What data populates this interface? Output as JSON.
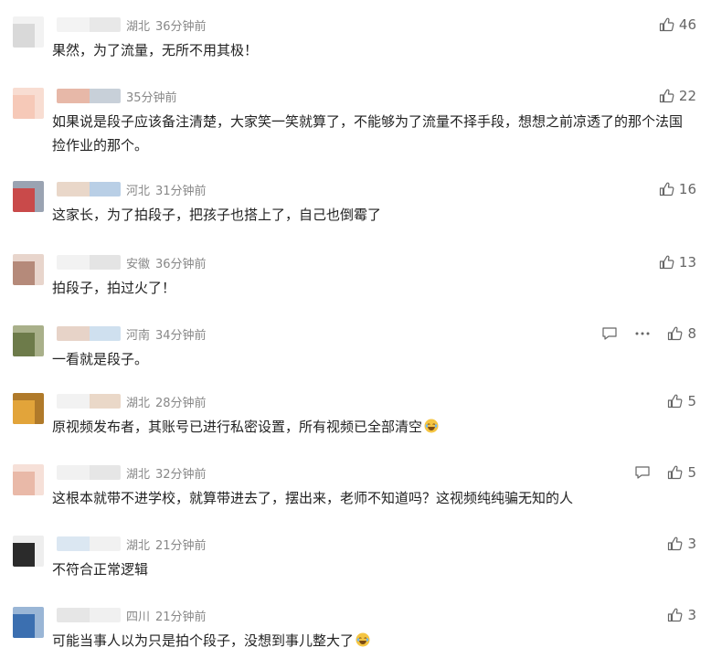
{
  "comments": [
    {
      "region": "湖北",
      "time": "36分钟前",
      "text": "果然，为了流量，无所不用其极！",
      "likes": "46",
      "avatar_colors": [
        "#d9d9d9",
        "#f2f2f2"
      ],
      "nick_colors": [
        "#f3f3f3",
        "#e8e8e8"
      ],
      "has_reply": false,
      "has_more": false
    },
    {
      "region": "",
      "time": "35分钟前",
      "text": "如果说是段子应该备注清楚，大家笑一笑就算了，不能够为了流量不择手段，想想之前凉透了的那个法国捡作业的那个。",
      "likes": "22",
      "avatar_colors": [
        "#f6c9b8",
        "#f8ddd2"
      ],
      "nick_colors": [
        "#e7b8a8",
        "#c8d0d9"
      ],
      "has_reply": false,
      "has_more": false
    },
    {
      "region": "河北",
      "time": "31分钟前",
      "text": "这家长，为了拍段子，把孩子也搭上了，自己也倒霉了",
      "likes": "16",
      "avatar_colors": [
        "#c94a4a",
        "#9aa3b2"
      ],
      "nick_colors": [
        "#e9d7c9",
        "#b9cfe6"
      ],
      "has_reply": false,
      "has_more": false
    },
    {
      "region": "安徽",
      "time": "36分钟前",
      "text": "拍段子，拍过火了！",
      "likes": "13",
      "avatar_colors": [
        "#b58a7a",
        "#e8d5cc"
      ],
      "nick_colors": [
        "#f2f2f2",
        "#e4e4e4"
      ],
      "has_reply": false,
      "has_more": false
    },
    {
      "region": "河南",
      "time": "34分钟前",
      "text": "一看就是段子。",
      "likes": "8",
      "avatar_colors": [
        "#6d7b4a",
        "#a9b08a"
      ],
      "nick_colors": [
        "#e7d3c8",
        "#cfe0ef"
      ],
      "has_reply": true,
      "has_more": true
    },
    {
      "region": "湖北",
      "time": "28分钟前",
      "text": "原视频发布者，其账号已进行私密设置，所有视频已全部清空",
      "likes": "5",
      "avatar_colors": [
        "#e2a43a",
        "#b07a2a"
      ],
      "nick_colors": [
        "#f2f2f2",
        "#ead8c8"
      ],
      "has_reply": false,
      "has_more": false,
      "emoji": "laugh"
    },
    {
      "region": "湖北",
      "time": "32分钟前",
      "text": "这根本就带不进学校，就算带进去了，摆出来，老师不知道吗？这视频纯纯骗无知的人",
      "likes": "5",
      "avatar_colors": [
        "#e9b9a8",
        "#f6e0d8"
      ],
      "nick_colors": [
        "#f1f1f1",
        "#e6e6e6"
      ],
      "has_reply": true,
      "has_more": false
    },
    {
      "region": "湖北",
      "time": "21分钟前",
      "text": "不符合正常逻辑",
      "likes": "3",
      "avatar_colors": [
        "#2b2b2b",
        "#eeeeee"
      ],
      "nick_colors": [
        "#dbe7f2",
        "#f1f1f1"
      ],
      "has_reply": false,
      "has_more": false
    },
    {
      "region": "四川",
      "time": "21分钟前",
      "text": "可能当事人以为只是拍个段子，没想到事儿整大了",
      "likes": "3",
      "avatar_colors": [
        "#3b6fb0",
        "#9ab6d6"
      ],
      "nick_colors": [
        "#e6e6e6",
        "#f0f0f0"
      ],
      "has_reply": false,
      "has_more": false,
      "emoji": "laugh"
    }
  ],
  "icons": {
    "like": "thumbs-up-icon",
    "reply": "reply-icon",
    "more": "more-icon",
    "emoji": "laughing-emoji-icon"
  },
  "colors": {
    "text": "#222222",
    "meta": "#888888",
    "icon": "#666666",
    "emoji": "#f5c542"
  }
}
